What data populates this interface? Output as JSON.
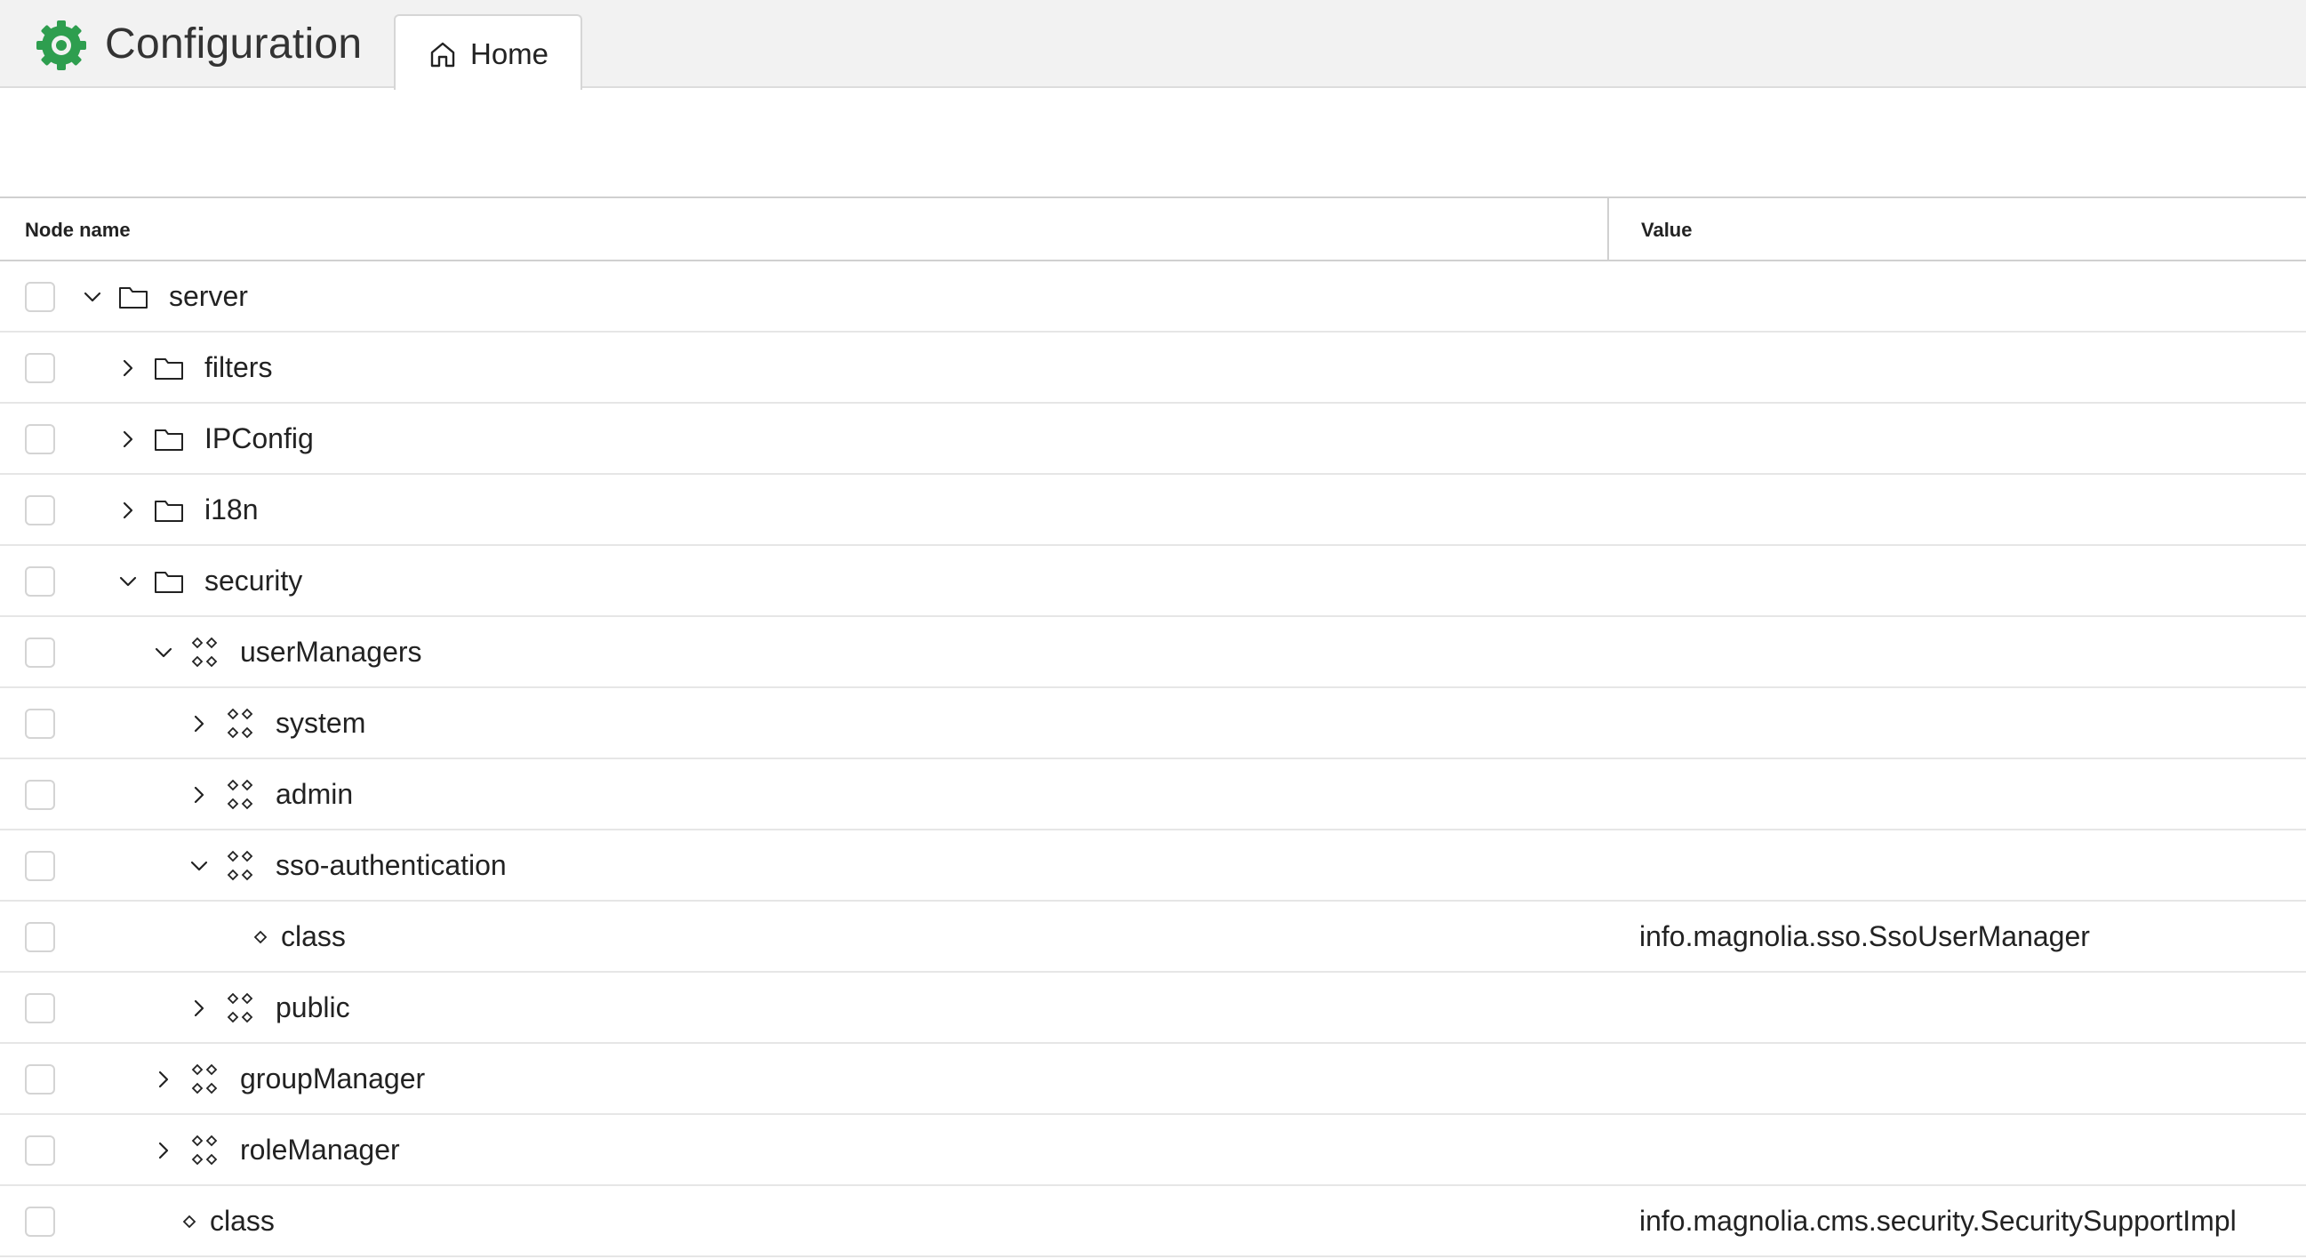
{
  "app": {
    "title": "Configuration",
    "brand_color": "#2e9e4f"
  },
  "tabs": [
    {
      "label": "Home",
      "icon": "home-icon",
      "active": true
    }
  ],
  "grid": {
    "columns": {
      "name": "Node name",
      "value": "Value"
    },
    "rows": [
      {
        "name": "server",
        "type": "folder",
        "depth": 0,
        "expanded": true,
        "value": ""
      },
      {
        "name": "filters",
        "type": "folder",
        "depth": 1,
        "expanded": false,
        "value": ""
      },
      {
        "name": "IPConfig",
        "type": "folder",
        "depth": 1,
        "expanded": false,
        "value": ""
      },
      {
        "name": "i18n",
        "type": "folder",
        "depth": 1,
        "expanded": false,
        "value": ""
      },
      {
        "name": "security",
        "type": "folder",
        "depth": 1,
        "expanded": true,
        "value": ""
      },
      {
        "name": "userManagers",
        "type": "content",
        "depth": 2,
        "expanded": true,
        "value": ""
      },
      {
        "name": "system",
        "type": "content",
        "depth": 3,
        "expanded": false,
        "value": ""
      },
      {
        "name": "admin",
        "type": "content",
        "depth": 3,
        "expanded": false,
        "value": ""
      },
      {
        "name": "sso-authentication",
        "type": "content",
        "depth": 3,
        "expanded": true,
        "value": ""
      },
      {
        "name": "class",
        "type": "property",
        "depth": 4,
        "expanded": null,
        "value": "info.magnolia.sso.SsoUserManager"
      },
      {
        "name": "public",
        "type": "content",
        "depth": 3,
        "expanded": false,
        "value": ""
      },
      {
        "name": "groupManager",
        "type": "content",
        "depth": 2,
        "expanded": false,
        "value": ""
      },
      {
        "name": "roleManager",
        "type": "content",
        "depth": 2,
        "expanded": false,
        "value": ""
      },
      {
        "name": "class",
        "type": "property",
        "depth": 2,
        "expanded": null,
        "value": "info.magnolia.cms.security.SecuritySupportImpl"
      }
    ]
  }
}
